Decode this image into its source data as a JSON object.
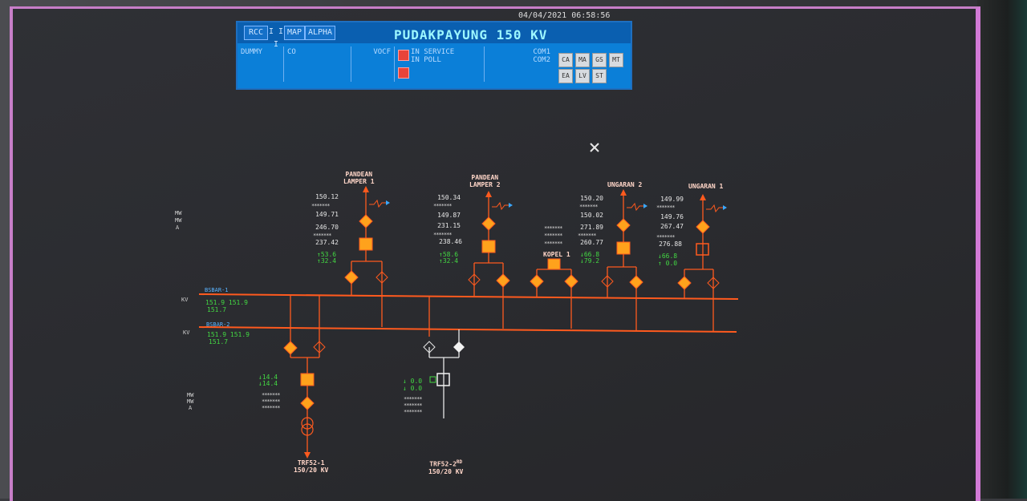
{
  "header": {
    "buttons": [
      "RCC",
      "I I I",
      "MAP",
      "ALPHA"
    ],
    "title": "PUDAKPAYUNG 150 KV",
    "datetime": "04/04/2021 06:58:56",
    "cells": [
      "DUMMY",
      "CO",
      "VOCF"
    ],
    "status_lines": [
      "IN SERVICE",
      "IN POLL"
    ],
    "com_labels": [
      "COM1",
      "COM2"
    ],
    "mini_buttons": [
      "CA",
      "MA",
      "GS",
      "MT",
      "EA",
      "LV",
      "ST"
    ]
  },
  "feeders": [
    {
      "name_line1": "PANDEAN",
      "name_line2": "LAMPER 1",
      "values": [
        "150.12",
        "149.71",
        "246.70",
        "237.42"
      ],
      "flows": [
        "↑53.6",
        "↑32.4"
      ]
    },
    {
      "name_line1": "PANDEAN",
      "name_line2": "LAMPER 2",
      "values": [
        "150.34",
        "149.87",
        "231.15",
        "238.46"
      ],
      "flows": [
        "↑58.6",
        "↑32.4"
      ]
    },
    {
      "name_line1": "UNGARAN 2",
      "name_line2": "",
      "values": [
        "150.20",
        "150.02",
        "271.89",
        "260.77"
      ],
      "flows": [
        "↓66.8",
        "↓79.2"
      ]
    },
    {
      "name_line1": "UNGARAN 1",
      "name_line2": "",
      "values": [
        "149.99",
        "149.76",
        "267.47",
        "276.88"
      ],
      "flows": [
        "↓66.8",
        "↑ 0.0"
      ]
    }
  ],
  "placeholder_dots": "*******",
  "coupler": {
    "label": "KOPEL 1"
  },
  "bus1": {
    "name": "BSBAR-1",
    "unit": "KV",
    "line1": "151.9  151.9",
    "line2": "151.7"
  },
  "bus2": {
    "name": "BSBAR-2",
    "unit": "KV",
    "line1": "151.9  151.9",
    "line2": "151.7"
  },
  "units_top": [
    "MW",
    "MW",
    "A"
  ],
  "units_bottom": [
    "MW",
    "MW",
    "A"
  ],
  "transformers": [
    {
      "name": "TRF52-1",
      "rating": "150/20 KV",
      "flows": [
        "↓14.4",
        "↓14.4"
      ]
    },
    {
      "name": "TRF52-2",
      "suffix": "RD",
      "rating": "150/20 KV",
      "flows": [
        "↓ 0.0",
        "↓ 0.0"
      ]
    }
  ],
  "colors": {
    "live": "#ff5a1e",
    "breaker": "#ffa21c",
    "dead": "#e8e8e8",
    "bus_text": "#43d843",
    "header_bg": "#0b7fd8"
  }
}
